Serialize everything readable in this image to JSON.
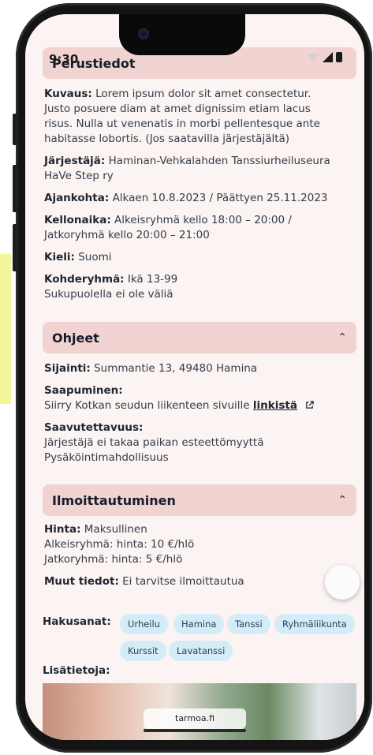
{
  "status_bar": {
    "time": "9:30"
  },
  "perustiedot": {
    "title": "Perustiedot",
    "kuvaus_label": "Kuvaus:",
    "kuvaus_lines": [
      "Lorem ipsum dolor sit amet consectetur.",
      "Justo posuere diam at amet dignissim etiam lacus",
      "risus. Nulla ut venenatis in morbi pellentesque ante",
      "habitasse lobortis. (Jos saatavilla järjestäjältä)"
    ],
    "jarjestaja_label": "Järjestäjä:",
    "jarjestaja_lines": [
      "Haminan-Vehkalahden Tanssiurheiluseura",
      "HaVe Step ry"
    ],
    "ajankohta_label": "Ajankohta:",
    "ajankohta_value": "Alkaen 10.8.2023 / Päättyen 25.11.2023",
    "kellonaika_label": "Kellonaika:",
    "kellonaika_lines": [
      "Alkeisryhmä kello 18:00 – 20:00 /",
      "Jatkoryhmä kello 20:00 – 21:00"
    ],
    "kieli_label": "Kieli:",
    "kieli_value": "Suomi",
    "kohderyhma_label": "Kohderyhmä:",
    "kohderyhma_lines": [
      "Ikä 13-99",
      "Sukupuolella ei ole väliä"
    ]
  },
  "ohjeet": {
    "title": "Ohjeet",
    "sijainti_label": "Sijainti:",
    "sijainti_value": "Summantie 13, 49480 Hamina",
    "saapuminen_label": "Saapuminen:",
    "saapuminen_text": "Siirry Kotkan seudun liikenteen sivuille",
    "saapuminen_link": "linkistä",
    "saavutettavuus_label": "Saavutettavuus:",
    "saavutettavuus_lines": [
      "Järjestäjä ei takaa paikan esteettömyyttä",
      "Pysäköintimahdollisuus"
    ]
  },
  "ilmoittautuminen": {
    "title": "Ilmoittautuminen",
    "hinta_label": "Hinta:",
    "hinta_value": "Maksullinen",
    "hinta_lines": [
      "Alkeisryhmä: hinta: 10 €/hlö",
      "Jatkoryhmä: hinta: 5 €/hlö"
    ],
    "muut_label": "Muut tiedot:",
    "muut_value": "Ei tarvitse ilmoittautua"
  },
  "hakusanat": {
    "label": "Hakusanat:",
    "tags": [
      "Urheilu",
      "Hamina",
      "Tanssi",
      "Ryhmäliikunta",
      "Kurssit",
      "Lavatanssi"
    ]
  },
  "lisatietoja_label": "Lisätietoja:",
  "browser": {
    "url": "tarmoa.fi"
  }
}
